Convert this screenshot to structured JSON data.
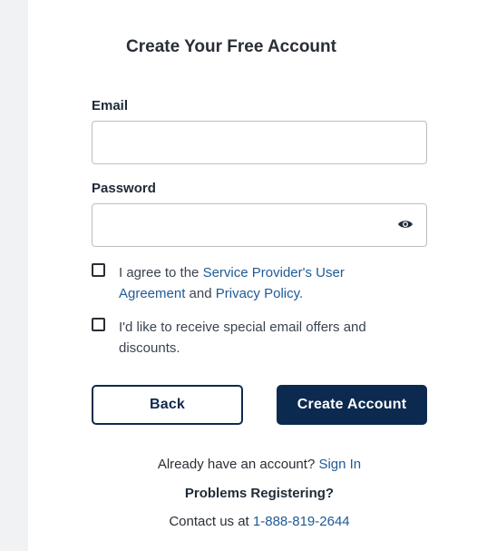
{
  "form": {
    "title": "Create Your Free Account",
    "email_label": "Email",
    "email_value": "",
    "password_label": "Password",
    "password_value": "",
    "password_toggle_icon": "eye-icon"
  },
  "agreements": {
    "terms_prefix": "I agree to the ",
    "terms_link": "Service Provider's User Agreement",
    "terms_and": " and ",
    "privacy_link": "Privacy Policy.",
    "offers_text": "I'd like to receive special email offers and discounts."
  },
  "buttons": {
    "back_label": "Back",
    "create_label": "Create Account"
  },
  "footer": {
    "signin_prefix": "Already have an account? ",
    "signin_link": "Sign In",
    "problems_heading": "Problems Registering?",
    "contact_prefix": "Contact us at ",
    "phone_link": "1-888-819-2644"
  },
  "colors": {
    "primary": "#0c2a4f",
    "link": "#1e5a96",
    "border": "#b9bec5",
    "gutter": "#f1f2f3"
  }
}
